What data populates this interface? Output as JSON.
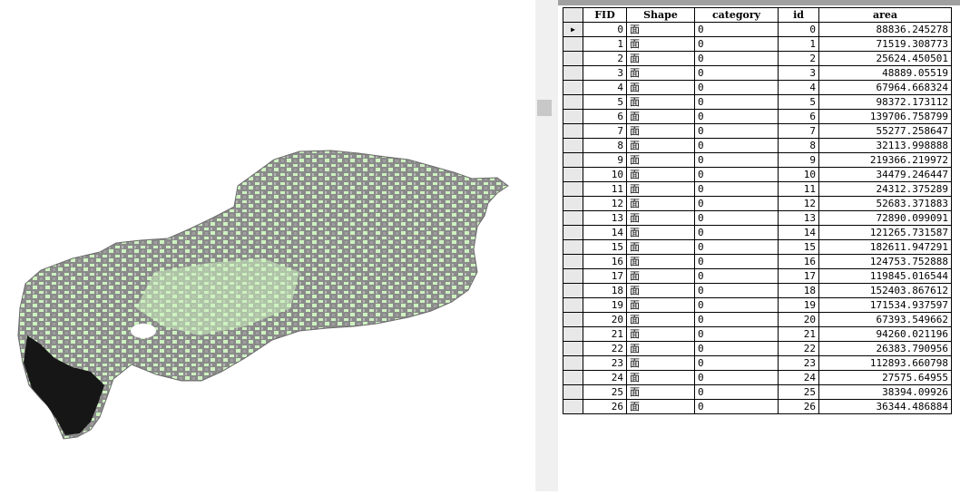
{
  "map": {
    "fill_colors": {
      "light_parcels": "#cdf2c0",
      "mid_parcels": "#8a8a8a",
      "dark_parcels": "#161616",
      "outline": "#6a6a6a"
    }
  },
  "table": {
    "columns": [
      "FID",
      "Shape",
      "category",
      "id",
      "area"
    ],
    "current_row_marker": "▶",
    "rows": [
      [
        "0",
        "面",
        "0",
        "0",
        "88836.245278"
      ],
      [
        "1",
        "面",
        "0",
        "1",
        "71519.308773"
      ],
      [
        "2",
        "面",
        "0",
        "2",
        "25624.450501"
      ],
      [
        "3",
        "面",
        "0",
        "3",
        "48889.05519"
      ],
      [
        "4",
        "面",
        "0",
        "4",
        "67964.668324"
      ],
      [
        "5",
        "面",
        "0",
        "5",
        "98372.173112"
      ],
      [
        "6",
        "面",
        "0",
        "6",
        "139706.758799"
      ],
      [
        "7",
        "面",
        "0",
        "7",
        "55277.258647"
      ],
      [
        "8",
        "面",
        "0",
        "8",
        "32113.998888"
      ],
      [
        "9",
        "面",
        "0",
        "9",
        "219366.219972"
      ],
      [
        "10",
        "面",
        "0",
        "10",
        "34479.246447"
      ],
      [
        "11",
        "面",
        "0",
        "11",
        "24312.375289"
      ],
      [
        "12",
        "面",
        "0",
        "12",
        "52683.371883"
      ],
      [
        "13",
        "面",
        "0",
        "13",
        "72890.099091"
      ],
      [
        "14",
        "面",
        "0",
        "14",
        "121265.731587"
      ],
      [
        "15",
        "面",
        "0",
        "15",
        "182611.947291"
      ],
      [
        "16",
        "面",
        "0",
        "16",
        "124753.752888"
      ],
      [
        "17",
        "面",
        "0",
        "17",
        "119845.016544"
      ],
      [
        "18",
        "面",
        "0",
        "18",
        "152403.867612"
      ],
      [
        "19",
        "面",
        "0",
        "19",
        "171534.937597"
      ],
      [
        "20",
        "面",
        "0",
        "20",
        "67393.549662"
      ],
      [
        "21",
        "面",
        "0",
        "21",
        "94260.021196"
      ],
      [
        "22",
        "面",
        "0",
        "22",
        "26383.790956"
      ],
      [
        "23",
        "面",
        "0",
        "23",
        "112893.660798"
      ],
      [
        "24",
        "面",
        "0",
        "24",
        "27575.64955"
      ],
      [
        "25",
        "面",
        "0",
        "25",
        "38394.09926"
      ],
      [
        "26",
        "面",
        "0",
        "26",
        "36344.486884"
      ]
    ]
  }
}
